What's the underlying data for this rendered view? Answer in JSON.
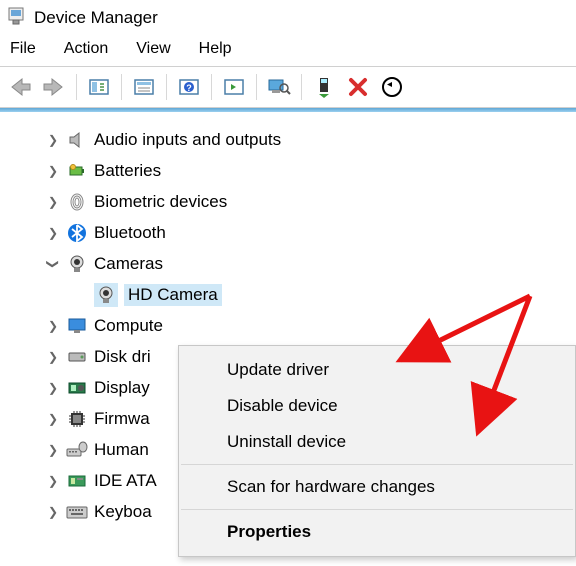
{
  "window": {
    "title": "Device Manager"
  },
  "menu": {
    "file": "File",
    "action": "Action",
    "view": "View",
    "help": "Help"
  },
  "tree": {
    "items": [
      {
        "label": "Audio inputs and outputs",
        "icon": "speaker",
        "expanded": false
      },
      {
        "label": "Batteries",
        "icon": "battery",
        "expanded": false
      },
      {
        "label": "Biometric devices",
        "icon": "fingerprint",
        "expanded": false
      },
      {
        "label": "Bluetooth",
        "icon": "bluetooth",
        "expanded": false
      },
      {
        "label": "Cameras",
        "icon": "camera",
        "expanded": true
      },
      {
        "label": "Compute",
        "icon": "monitor",
        "expanded": false
      },
      {
        "label": "Disk dri",
        "icon": "disk",
        "expanded": false
      },
      {
        "label": "Display",
        "icon": "gpu",
        "expanded": false
      },
      {
        "label": "Firmwa",
        "icon": "chip",
        "expanded": false
      },
      {
        "label": "Human",
        "icon": "hid",
        "expanded": false
      },
      {
        "label": "IDE ATA",
        "icon": "ide",
        "expanded": false
      },
      {
        "label": "Keyboa",
        "icon": "keyboard",
        "expanded": false
      }
    ],
    "camera_child": {
      "label": "HD Camera"
    }
  },
  "context_menu": {
    "update": "Update driver",
    "disable": "Disable device",
    "uninstall": "Uninstall device",
    "scan": "Scan for hardware changes",
    "properties": "Properties"
  }
}
